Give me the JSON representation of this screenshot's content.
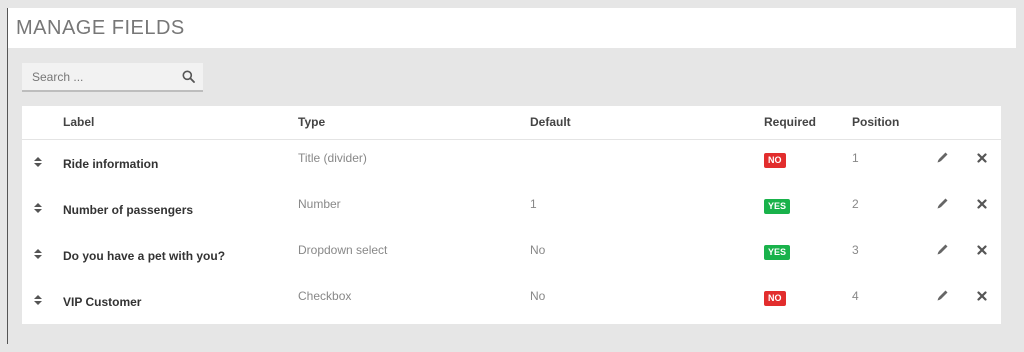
{
  "page": {
    "title": "MANAGE FIELDS"
  },
  "search": {
    "placeholder": "Search ..."
  },
  "table": {
    "headers": {
      "label": "Label",
      "type": "Type",
      "default": "Default",
      "required": "Required",
      "position": "Position"
    },
    "rows": [
      {
        "label": "Ride information",
        "type": "Title (divider)",
        "default": "",
        "required": "NO",
        "position": "1"
      },
      {
        "label": "Number of passengers",
        "type": "Number",
        "default": "1",
        "required": "YES",
        "position": "2"
      },
      {
        "label": "Do you have a pet with you?",
        "type": "Dropdown select",
        "default": "No",
        "required": "YES",
        "position": "3"
      },
      {
        "label": "VIP Customer",
        "type": "Checkbox",
        "default": "No",
        "required": "NO",
        "position": "4"
      }
    ]
  },
  "icons": {
    "search": "search-icon",
    "drag": "drag-handle-icon",
    "edit": "pencil-icon",
    "delete": "close-icon"
  },
  "colors": {
    "required_no": "#e22d2d",
    "required_yes": "#19b24b"
  }
}
